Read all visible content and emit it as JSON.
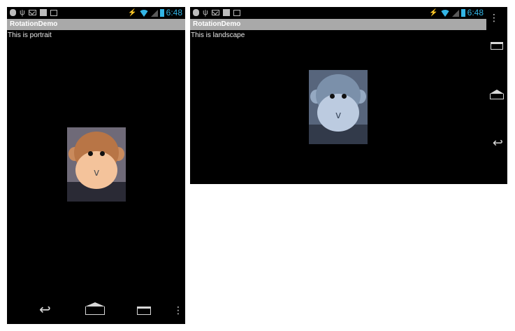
{
  "portrait": {
    "status_time": "6:48",
    "app_title": "RotationDemo",
    "message": "This is portrait",
    "image_colors": {
      "fur": "#b87546",
      "face": "#f4c39b"
    }
  },
  "landscape": {
    "status_time": "6:48",
    "app_title": "RotationDemo",
    "message": "This is landscape",
    "image_colors": {
      "fur": "#7b90aa",
      "face": "#bccbe0"
    }
  },
  "colors": {
    "status_accent": "#33b5e5",
    "title_bar": "#a9a9a9",
    "screen_bg": "#000000"
  },
  "icons": {
    "status_left": [
      "usb-debug-icon",
      "usb-icon",
      "email-icon",
      "download-icon",
      "calendar-icon"
    ],
    "status_right": [
      "running-icon",
      "wifi-icon",
      "signal-icon",
      "battery-icon"
    ],
    "nav": [
      "back-icon",
      "home-icon",
      "recent-apps-icon",
      "overflow-menu-icon"
    ]
  }
}
